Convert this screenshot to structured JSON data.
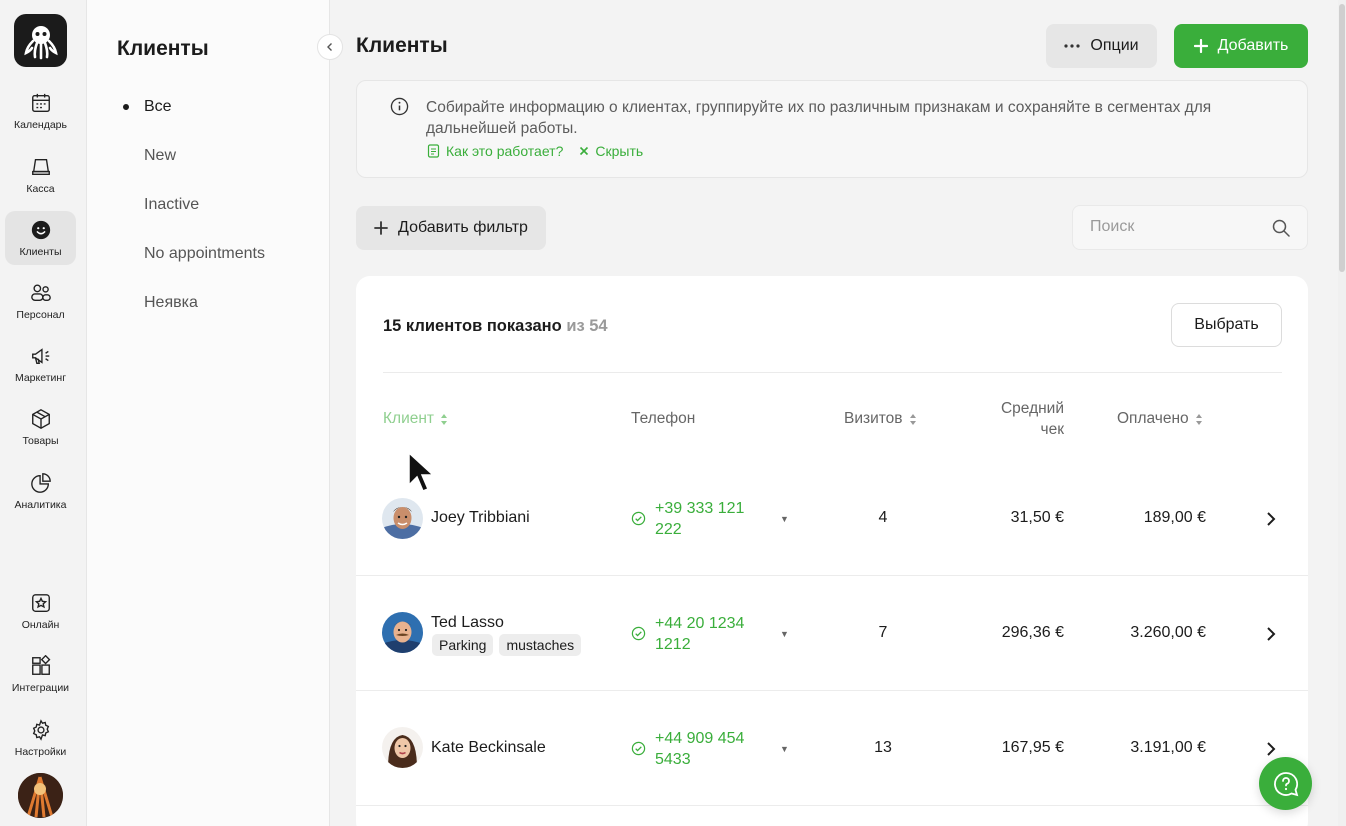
{
  "colors": {
    "accent": "#3aae3b",
    "text": "#1c1c1c",
    "muted": "#9a9a9a"
  },
  "rail": {
    "items": [
      {
        "label": "Календарь",
        "icon": "calendar-icon"
      },
      {
        "label": "Касса",
        "icon": "cash-register-icon"
      },
      {
        "label": "Клиенты",
        "icon": "smile-icon",
        "active": true
      },
      {
        "label": "Персонал",
        "icon": "staff-icon"
      },
      {
        "label": "Маркетинг",
        "icon": "megaphone-icon"
      },
      {
        "label": "Товары",
        "icon": "box-icon"
      },
      {
        "label": "Аналитика",
        "icon": "pie-chart-icon"
      },
      {
        "label": "Онлайн",
        "icon": "star-badge-icon"
      },
      {
        "label": "Интеграции",
        "icon": "integrations-icon"
      },
      {
        "label": "Настройки",
        "icon": "gear-icon"
      }
    ]
  },
  "segments": {
    "title": "Клиенты",
    "items": [
      "Все",
      "New",
      "Inactive",
      "No appointments",
      "Неявка"
    ],
    "active": "Все"
  },
  "header": {
    "title": "Клиенты",
    "options_label": "Опции",
    "add_label": "Добавить"
  },
  "info": {
    "text": "Собирайте информацию о клиентах, группируйте их по различным признакам и сохраняйте в сегментах для дальнейшей работы.",
    "how_label": "Как это работает?",
    "hide_label": "Скрыть"
  },
  "toolbar": {
    "filter_label": "Добавить фильтр",
    "search_placeholder": "Поиск"
  },
  "table": {
    "count_shown": "15 клиентов показано",
    "count_total": "из 54",
    "select_label": "Выбрать",
    "columns": {
      "client": "Клиент",
      "phone": "Телефон",
      "visits": "Визитов",
      "avg_line1": "Средний",
      "avg_line2": "чек",
      "paid": "Оплачено"
    },
    "rows": [
      {
        "name": "Joey Tribbiani",
        "tags": [],
        "phone_l1": "+39 333 121",
        "phone_l2": "222",
        "visits": "4",
        "avg": "31,50 €",
        "paid": "189,00 €"
      },
      {
        "name": "Ted Lasso",
        "tags": [
          "Parking",
          "mustaches"
        ],
        "phone_l1": "+44 20 1234",
        "phone_l2": "1212",
        "visits": "7",
        "avg": "296,36 €",
        "paid": "3.260,00 €"
      },
      {
        "name": "Kate Beckinsale",
        "tags": [],
        "phone_l1": "+44 909 454",
        "phone_l2": "5433",
        "visits": "13",
        "avg": "167,95 €",
        "paid": "3.191,00 €"
      }
    ]
  }
}
